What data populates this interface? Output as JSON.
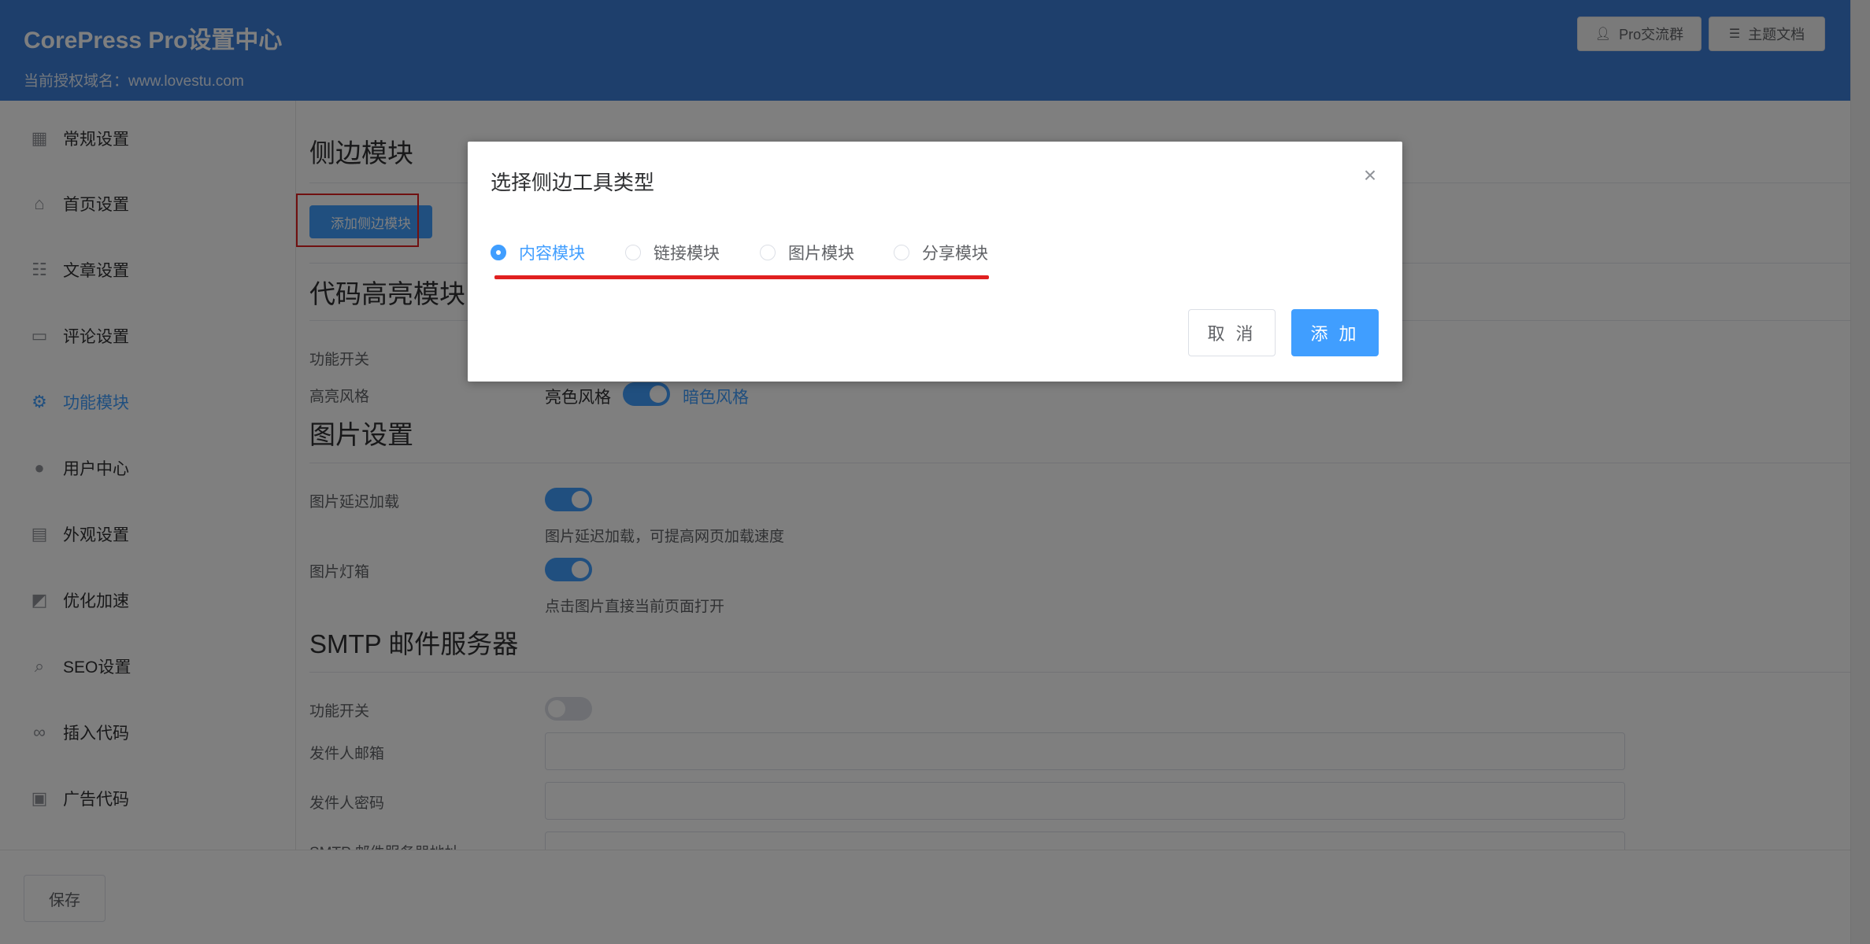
{
  "header": {
    "title": "CorePress Pro设置中心",
    "domain_text": "当前授权域名：www.lovestu.com",
    "buttons": [
      {
        "label": "Pro交流群",
        "icon": "user-icon"
      },
      {
        "label": "主题文档",
        "icon": "document-icon"
      }
    ]
  },
  "sidebar": {
    "items": [
      {
        "label": "常规设置",
        "icon": "grid-icon",
        "active": false
      },
      {
        "label": "首页设置",
        "icon": "home-icon",
        "active": false
      },
      {
        "label": "文章设置",
        "icon": "document-icon",
        "active": false
      },
      {
        "label": "评论设置",
        "icon": "chat-icon",
        "active": false
      },
      {
        "label": "功能模块",
        "icon": "gear-icon",
        "active": true
      },
      {
        "label": "用户中心",
        "icon": "user-icon",
        "active": false
      },
      {
        "label": "外观设置",
        "icon": "brush-icon",
        "active": false
      },
      {
        "label": "优化加速",
        "icon": "chart-icon",
        "active": false
      },
      {
        "label": "SEO设置",
        "icon": "search-icon",
        "active": false
      },
      {
        "label": "插入代码",
        "icon": "link-icon",
        "active": false
      },
      {
        "label": "广告代码",
        "icon": "clipboard-icon",
        "active": false
      }
    ]
  },
  "main": {
    "sidebar_module": {
      "title": "侧边模块",
      "add_button": "添加侧边模块"
    },
    "code_highlight": {
      "title": "代码高亮模块",
      "feature_label": "功能开关",
      "style_label": "高亮风格",
      "style_off_text": "亮色风格",
      "style_on_text": "暗色风格",
      "style_on": true
    },
    "image_settings": {
      "title": "图片设置",
      "lazy_label": "图片延迟加载",
      "lazy_on": true,
      "lazy_desc": "图片延迟加载，可提高网页加载速度",
      "lightbox_label": "图片灯箱",
      "lightbox_on": true,
      "lightbox_desc": "点击图片直接当前页面打开"
    },
    "smtp": {
      "title": "SMTP 邮件服务器",
      "feature_label": "功能开关",
      "feature_on": false,
      "sender_email_label": "发件人邮箱",
      "sender_email_value": "",
      "sender_password_label": "发件人密码",
      "sender_password_value": "",
      "server_label": "SMTP 邮件服务器地址"
    }
  },
  "footer": {
    "save_label": "保存"
  },
  "dialog": {
    "title": "选择侧边工具类型",
    "options": [
      {
        "label": "内容模块",
        "checked": true
      },
      {
        "label": "链接模块",
        "checked": false
      },
      {
        "label": "图片模块",
        "checked": false
      },
      {
        "label": "分享模块",
        "checked": false
      }
    ],
    "cancel_label": "取 消",
    "confirm_label": "添 加"
  },
  "colors": {
    "primary": "#409eff",
    "header": "#3d7fd9",
    "highlight": "#e02020"
  }
}
